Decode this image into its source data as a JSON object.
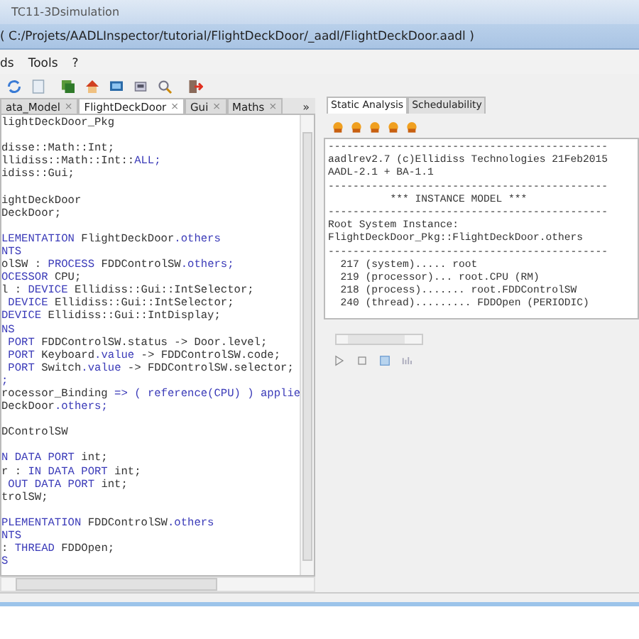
{
  "window": {
    "title": "TC11-3Dsimulation"
  },
  "path_bar": "( C:/Projets/AADLInspector/tutorial/FlightDeckDoor/_aadl/FlightDeckDoor.aadl )",
  "menu": [
    "ds",
    "Tools",
    "?"
  ],
  "editor": {
    "tabs": [
      {
        "label": "ata_Model",
        "selected": false
      },
      {
        "label": "FlightDeckDoor",
        "selected": true
      },
      {
        "label": "Gui",
        "selected": false
      },
      {
        "label": "Maths",
        "selected": false
      }
    ],
    "tab_close": "×",
    "tab_overflow": "»",
    "lines": [
      {
        "kind": "code",
        "segments": [
          {
            "text": "lightDeckDoor_Pkg",
            "kind": "plain"
          }
        ]
      },
      {
        "kind": "blank"
      },
      {
        "kind": "code",
        "segments": [
          {
            "text": "disse::Math::Int;",
            "kind": "plain"
          }
        ]
      },
      {
        "kind": "code",
        "segments": [
          {
            "text": "llidiss::Math::Int::",
            "kind": "plain"
          },
          {
            "text": "ALL;",
            "kind": "keyword"
          }
        ]
      },
      {
        "kind": "code",
        "segments": [
          {
            "text": "idiss::Gui;",
            "kind": "plain"
          }
        ]
      },
      {
        "kind": "blank"
      },
      {
        "kind": "code",
        "segments": [
          {
            "text": "ightDeckDoor",
            "kind": "plain"
          }
        ]
      },
      {
        "kind": "code",
        "segments": [
          {
            "text": "DeckDoor;",
            "kind": "plain"
          }
        ]
      },
      {
        "kind": "blank"
      },
      {
        "kind": "code",
        "segments": [
          {
            "text": "LEMENTATION",
            "kind": "keyword"
          },
          {
            "text": " FlightDeckDoor",
            "kind": "plain"
          },
          {
            "text": ".others",
            "kind": "keyword"
          }
        ]
      },
      {
        "kind": "code",
        "segments": [
          {
            "text": "NTS",
            "kind": "keyword"
          }
        ]
      },
      {
        "kind": "code",
        "segments": [
          {
            "text": "olSW : ",
            "kind": "plain"
          },
          {
            "text": "PROCESS",
            "kind": "keyword"
          },
          {
            "text": " FDDControlSW",
            "kind": "plain"
          },
          {
            "text": ".others;",
            "kind": "keyword"
          }
        ]
      },
      {
        "kind": "code",
        "segments": [
          {
            "text": "OCESSOR",
            "kind": "keyword"
          },
          {
            "text": " CPU;",
            "kind": "plain"
          }
        ]
      },
      {
        "kind": "code",
        "segments": [
          {
            "text": "l : ",
            "kind": "plain"
          },
          {
            "text": "DEVICE",
            "kind": "keyword"
          },
          {
            "text": " Ellidiss::Gui::IntSelector;",
            "kind": "plain"
          }
        ]
      },
      {
        "kind": "code",
        "segments": [
          {
            "text": " DEVICE",
            "kind": "keyword"
          },
          {
            "text": " Ellidiss::Gui::IntSelector;",
            "kind": "plain"
          }
        ]
      },
      {
        "kind": "code",
        "segments": [
          {
            "text": "DEVICE",
            "kind": "keyword"
          },
          {
            "text": " Ellidiss::Gui::IntDisplay;",
            "kind": "plain"
          }
        ]
      },
      {
        "kind": "code",
        "segments": [
          {
            "text": "NS",
            "kind": "keyword"
          }
        ]
      },
      {
        "kind": "code",
        "segments": [
          {
            "text": " PORT",
            "kind": "keyword"
          },
          {
            "text": " FDDControlSW.status -> Door.level;",
            "kind": "plain"
          }
        ]
      },
      {
        "kind": "code",
        "segments": [
          {
            "text": " PORT",
            "kind": "keyword"
          },
          {
            "text": " Keyboard",
            "kind": "plain"
          },
          {
            "text": ".value",
            "kind": "keyword"
          },
          {
            "text": " -> FDDControlSW.code;",
            "kind": "plain"
          }
        ]
      },
      {
        "kind": "code",
        "segments": [
          {
            "text": " PORT",
            "kind": "keyword"
          },
          {
            "text": " Switch",
            "kind": "plain"
          },
          {
            "text": ".value",
            "kind": "keyword"
          },
          {
            "text": " -> FDDControlSW.selector;",
            "kind": "plain"
          }
        ]
      },
      {
        "kind": "code",
        "segments": [
          {
            "text": ";",
            "kind": "keyword"
          }
        ]
      },
      {
        "kind": "code",
        "segments": [
          {
            "text": "rocessor_Binding ",
            "kind": "plain"
          },
          {
            "text": "=> ( reference(CPU) ) applie",
            "kind": "keyword"
          }
        ]
      },
      {
        "kind": "code",
        "segments": [
          {
            "text": "DeckDoor",
            "kind": "plain"
          },
          {
            "text": ".others;",
            "kind": "keyword"
          }
        ]
      },
      {
        "kind": "blank"
      },
      {
        "kind": "code",
        "segments": [
          {
            "text": "DControlSW",
            "kind": "plain"
          }
        ]
      },
      {
        "kind": "blank"
      },
      {
        "kind": "code",
        "segments": [
          {
            "text": "N DATA PORT",
            "kind": "keyword"
          },
          {
            "text": " int;",
            "kind": "plain"
          }
        ]
      },
      {
        "kind": "code",
        "segments": [
          {
            "text": "r : ",
            "kind": "plain"
          },
          {
            "text": "IN DATA PORT",
            "kind": "keyword"
          },
          {
            "text": " int;",
            "kind": "plain"
          }
        ]
      },
      {
        "kind": "code",
        "segments": [
          {
            "text": " OUT DATA PORT",
            "kind": "keyword"
          },
          {
            "text": " int;",
            "kind": "plain"
          }
        ]
      },
      {
        "kind": "code",
        "segments": [
          {
            "text": "trolSW;",
            "kind": "plain"
          }
        ]
      },
      {
        "kind": "blank"
      },
      {
        "kind": "code",
        "segments": [
          {
            "text": "PLEMENTATION",
            "kind": "keyword"
          },
          {
            "text": " FDDControlSW",
            "kind": "plain"
          },
          {
            "text": ".others",
            "kind": "keyword"
          }
        ]
      },
      {
        "kind": "code",
        "segments": [
          {
            "text": "NTS",
            "kind": "keyword"
          }
        ]
      },
      {
        "kind": "code",
        "segments": [
          {
            "text": ": ",
            "kind": "plain"
          },
          {
            "text": "THREAD",
            "kind": "keyword"
          },
          {
            "text": " FDDOpen;",
            "kind": "plain"
          }
        ]
      },
      {
        "kind": "code",
        "segments": [
          {
            "text": "S",
            "kind": "keyword"
          }
        ]
      }
    ]
  },
  "analysis": {
    "tabs": [
      {
        "label": "Static Analysis",
        "selected": true
      },
      {
        "label": "Schedulability",
        "selected": false
      }
    ],
    "output": [
      "---------------------------------------------",
      "aadlrev2.7 (c)Ellidiss Technologies 21Feb2015",
      "AADL-2.1 + BA-1.1",
      "---------------------------------------------",
      "          *** INSTANCE MODEL ***",
      "---------------------------------------------",
      "Root System Instance:",
      "FlightDeckDoor_Pkg::FlightDeckDoor.others",
      "---------------------------------------------",
      "  217 (system)..... root",
      "  219 (processor)... root.CPU (RM)",
      "  218 (process)....... root.FDDControlSW",
      "  240 (thread)......... FDDOpen (PERIODIC)"
    ]
  }
}
